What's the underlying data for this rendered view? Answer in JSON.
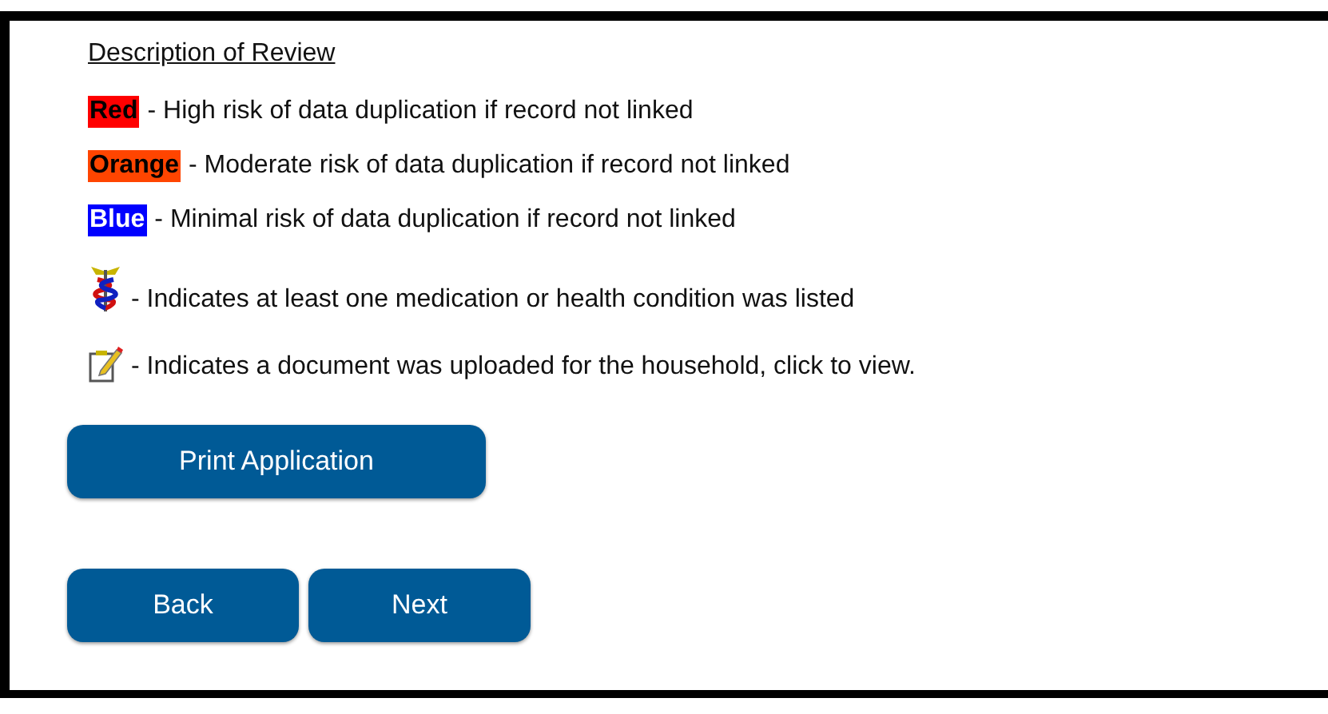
{
  "legend": {
    "heading": "Description of Review",
    "items": [
      {
        "kind": "swatch",
        "label": "Red",
        "color": "#ff0000",
        "text": "- High risk of data duplication if record not linked"
      },
      {
        "kind": "swatch",
        "label": "Orange",
        "color": "#ff4500",
        "text": "- Moderate risk of data duplication if record not linked"
      },
      {
        "kind": "swatch",
        "label": "Blue",
        "color": "#0000ff",
        "text": "- Minimal risk of data duplication if record not linked"
      },
      {
        "kind": "medical",
        "text": "- Indicates at least one medication or health condition was listed"
      },
      {
        "kind": "document",
        "text": "- Indicates a document was uploaded for the household, click to view."
      }
    ]
  },
  "print_button": "Print Application",
  "nav_buttons": [
    "Back",
    "Next"
  ]
}
